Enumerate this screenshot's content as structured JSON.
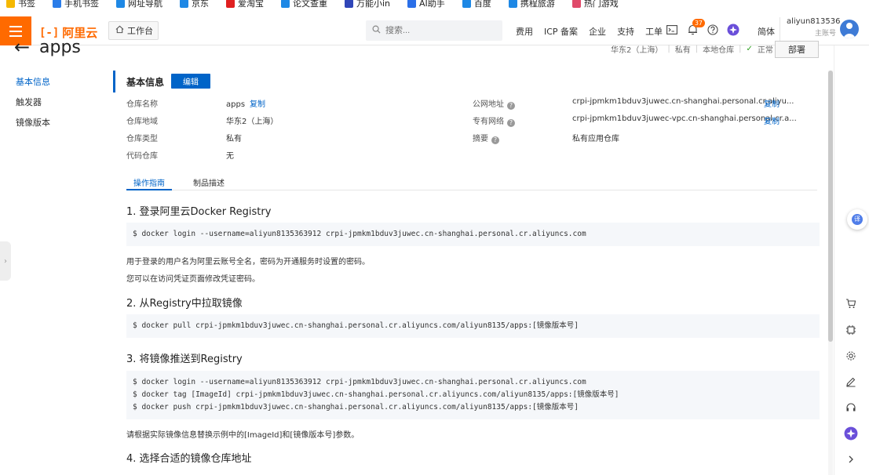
{
  "bookmarks": [
    {
      "label": "书签",
      "color": "#f5b800"
    },
    {
      "label": "手机书签",
      "color": "#2b7de9"
    },
    {
      "label": "网址导航",
      "color": "#1e88e5"
    },
    {
      "label": "京东",
      "color": "#1e88e5"
    },
    {
      "label": "爱淘宝",
      "color": "#e02020"
    },
    {
      "label": "论文查重",
      "color": "#1e88e5"
    },
    {
      "label": "万能小in",
      "color": "#3046b8"
    },
    {
      "label": "AI助手",
      "color": "#2b6fe8"
    },
    {
      "label": "百度",
      "color": "#1e88e5"
    },
    {
      "label": "携程旅游",
      "color": "#1e88e5"
    },
    {
      "label": "热门游戏",
      "color": "#e04a6a"
    }
  ],
  "header": {
    "logo_text": "阿里云",
    "logo_mark": "[-]",
    "workbench": "工作台",
    "search_placeholder": "搜索...",
    "nav": [
      "费用",
      "ICP 备案",
      "企业",
      "支持",
      "工单"
    ],
    "notification_count": "37",
    "lang": "简体",
    "username": "aliyun813536...",
    "user_role": "主账号"
  },
  "page": {
    "title": "apps",
    "region": "华东2（上海）",
    "visibility": "私有",
    "repo_type": "本地仓库",
    "status": "正常",
    "deploy_label": "部署"
  },
  "leftnav": [
    "基本信息",
    "触发器",
    "镜像版本"
  ],
  "basic": {
    "section_title": "基本信息",
    "edit_label": "编辑",
    "copy_label": "复制",
    "left": [
      {
        "k": "仓库名称",
        "v": "apps",
        "copy": true
      },
      {
        "k": "仓库地域",
        "v": "华东2（上海）",
        "copy": false
      },
      {
        "k": "仓库类型",
        "v": "私有",
        "copy": false
      },
      {
        "k": "代码仓库",
        "v": "无",
        "copy": false
      }
    ],
    "right": [
      {
        "k": "公网地址",
        "v": "crpi-jpmkm1bduv3juwec.cn-shanghai.personal.cr.aliyu...",
        "copy": true
      },
      {
        "k": "专有网络",
        "v": "crpi-jpmkm1bduv3juwec-vpc.cn-shanghai.personal.cr.a...",
        "copy": true
      },
      {
        "k": "摘要",
        "v": "私有应用仓库",
        "copy": false
      }
    ]
  },
  "tabs": [
    "操作指南",
    "制品描述"
  ],
  "guide": {
    "s1_title": "1. 登录阿里云Docker Registry",
    "s1_code": [
      "$ docker login --username=aliyun8135363912 crpi-jpmkm1bduv3juwec.cn-shanghai.personal.cr.aliyuncs.com"
    ],
    "s1_p1": "用于登录的用户名为阿里云账号全名，密码为开通服务时设置的密码。",
    "s1_p2": "您可以在访问凭证页面修改凭证密码。",
    "s2_title": "2. 从Registry中拉取镜像",
    "s2_code": [
      "$ docker pull crpi-jpmkm1bduv3juwec.cn-shanghai.personal.cr.aliyuncs.com/aliyun8135/apps:[镜像版本号]"
    ],
    "s3_title": "3. 将镜像推送到Registry",
    "s3_code": [
      "$ docker login --username=aliyun8135363912 crpi-jpmkm1bduv3juwec.cn-shanghai.personal.cr.aliyuncs.com",
      "$ docker tag [ImageId] crpi-jpmkm1bduv3juwec.cn-shanghai.personal.cr.aliyuncs.com/aliyun8135/apps:[镜像版本号]",
      "$ docker push crpi-jpmkm1bduv3juwec.cn-shanghai.personal.cr.aliyuncs.com/aliyun8135/apps:[镜像版本号]"
    ],
    "s3_p": "请根据实际镜像信息替换示例中的[ImageId]和[镜像版本号]参数。",
    "s4_title": "4. 选择合适的镜像仓库地址"
  },
  "colors": {
    "brand": "#ff6a00",
    "primary": "#0064c8",
    "success": "#2ea121"
  }
}
